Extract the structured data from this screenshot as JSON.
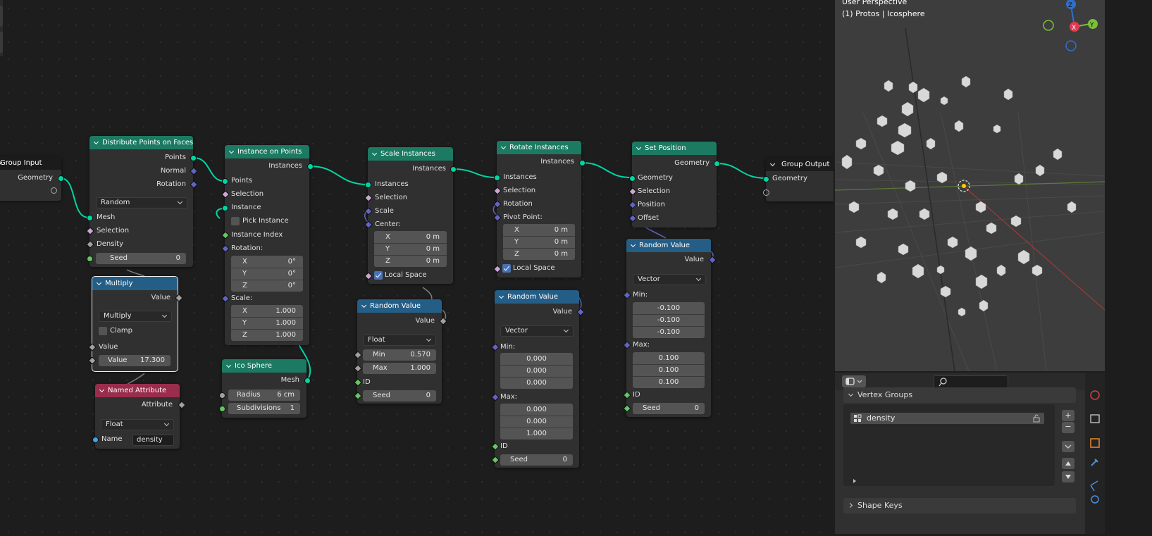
{
  "nodes": {
    "group_input": {
      "title": "Group Input",
      "geometry": "Geometry"
    },
    "distribute": {
      "title": "Distribute Points on Faces",
      "points": "Points",
      "normal": "Normal",
      "rotation": "Rotation",
      "mode": "Random",
      "mesh": "Mesh",
      "selection": "Selection",
      "density": "Density",
      "seed_label": "Seed",
      "seed_value": "0"
    },
    "multiply": {
      "title": "Multiply",
      "value_out": "Value",
      "operation": "Multiply",
      "clamp": "Clamp",
      "value_in": "Value",
      "value_label": "Value",
      "value": "17.300"
    },
    "named_attribute": {
      "title": "Named Attribute",
      "attribute": "Attribute",
      "type": "Float",
      "name_label": "Name",
      "name_value": "density"
    },
    "instance_on_points": {
      "title": "Instance on Points",
      "instances": "Instances",
      "points": "Points",
      "selection": "Selection",
      "instance": "Instance",
      "pick_instance": "Pick Instance",
      "instance_index": "Instance Index",
      "rotation": "Rotation:",
      "rx": "0°",
      "ry": "0°",
      "rz": "0°",
      "scale": "Scale:",
      "sx": "1.000",
      "sy": "1.000",
      "sz": "1.000",
      "x": "X",
      "y": "Y",
      "z": "Z"
    },
    "ico_sphere": {
      "title": "Ico Sphere",
      "mesh": "Mesh",
      "radius_label": "Radius",
      "radius": "6 cm",
      "subdiv_label": "Subdivisions",
      "subdiv": "1"
    },
    "scale_instances": {
      "title": "Scale Instances",
      "instances_out": "Instances",
      "instances_in": "Instances",
      "selection": "Selection",
      "scale": "Scale",
      "center": "Center:",
      "cx": "0 m",
      "cy": "0 m",
      "cz": "0 m",
      "local_space": "Local Space",
      "x": "X",
      "y": "Y",
      "z": "Z"
    },
    "random_value_float": {
      "title": "Random Value",
      "value": "Value",
      "type": "Float",
      "min_label": "Min",
      "min": "0.570",
      "max_label": "Max",
      "max": "1.000",
      "id": "ID",
      "seed_label": "Seed",
      "seed": "0"
    },
    "rotate_instances": {
      "title": "Rotate Instances",
      "instances_out": "Instances",
      "instances_in": "Instances",
      "selection": "Selection",
      "rotation": "Rotation",
      "pivot": "Pivot Point:",
      "px": "0 m",
      "py": "0 m",
      "pz": "0 m",
      "local_space": "Local Space",
      "x": "X",
      "y": "Y",
      "z": "Z"
    },
    "random_value_vec1": {
      "title": "Random Value",
      "value": "Value",
      "type": "Vector",
      "min_label": "Min:",
      "min": [
        "0.000",
        "0.000",
        "0.000"
      ],
      "max_label": "Max:",
      "max": [
        "0.000",
        "0.000",
        "1.000"
      ],
      "id": "ID",
      "seed_label": "Seed",
      "seed": "0"
    },
    "set_position": {
      "title": "Set Position",
      "geometry_out": "Geometry",
      "geometry_in": "Geometry",
      "selection": "Selection",
      "position": "Position",
      "offset": "Offset"
    },
    "random_value_vec2": {
      "title": "Random Value",
      "value": "Value",
      "type": "Vector",
      "min_label": "Min:",
      "min": [
        "-0.100",
        "-0.100",
        "-0.100"
      ],
      "max_label": "Max:",
      "max": [
        "0.100",
        "0.100",
        "0.100"
      ],
      "id": "ID",
      "seed_label": "Seed",
      "seed": "0"
    },
    "group_output": {
      "title": "Group Output",
      "geometry": "Geometry"
    }
  },
  "viewport": {
    "line1": "User Perspective",
    "line2": "(1) Protos | Icosphere",
    "gizmo": {
      "z": "Z",
      "x": "X",
      "y": "Y"
    }
  },
  "properties": {
    "vertex_groups": "Vertex Groups",
    "group_item": "density",
    "shape_keys": "Shape Keys"
  },
  "colors": {
    "geometry_socket": "#00d6a3",
    "float_socket": "#a1a1a1",
    "vector_socket": "#6363c7",
    "int_socket": "#63c763",
    "accent_blue": "#4772b3"
  }
}
